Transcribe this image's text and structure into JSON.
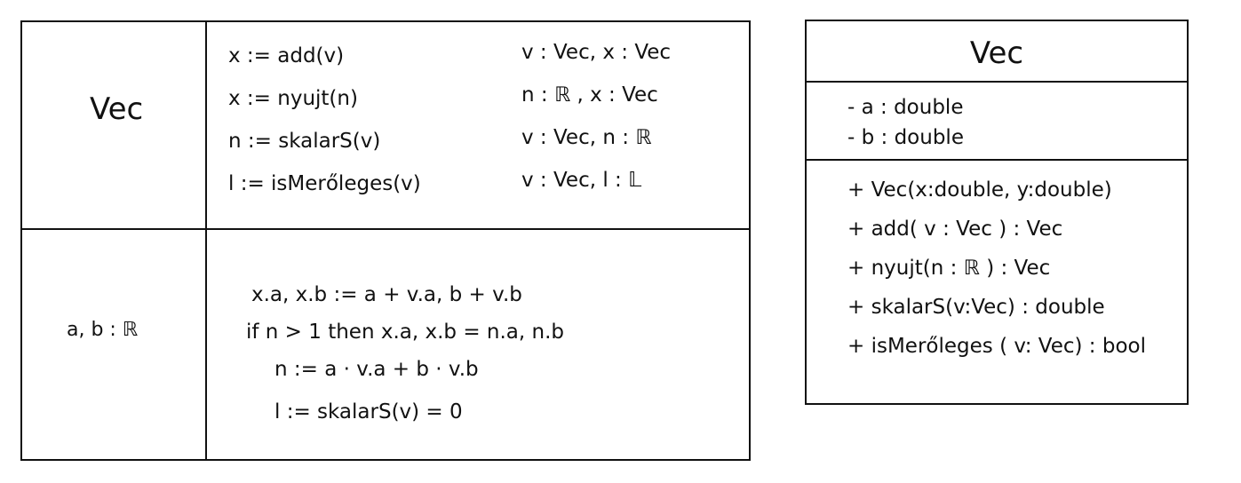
{
  "spec_table": {
    "type_name": "Vec",
    "representation": "a, b : ℝ",
    "operations": [
      {
        "lhs": "x := add(v)",
        "signature": "v : Vec, x : Vec"
      },
      {
        "lhs": "x := nyujt(n)",
        "signature": "n : ℝ , x : Vec"
      },
      {
        "lhs": "n := skalarS(v)",
        "signature": "v : Vec, n : ℝ"
      },
      {
        "lhs": "l := isMerőleges(v)",
        "signature": "v : Vec, l : 𝕃"
      }
    ],
    "implementation": [
      "x.a, x.b := a + v.a, b + v.b",
      "if n > 1 then x.a, x.b = n.a, n.b",
      "n := a · v.a + b · v.b",
      "l := skalarS(v) = 0"
    ]
  },
  "uml_class": {
    "name": "Vec",
    "attributes": [
      "- a : double",
      "- b : double"
    ],
    "methods": [
      "+ Vec(x:double, y:double)",
      "+ add( v : Vec ) : Vec",
      "+ nyujt(n : ℝ ) : Vec",
      "+ skalarS(v:Vec) : double",
      "+ isMerőleges ( v: Vec) : bool"
    ]
  }
}
